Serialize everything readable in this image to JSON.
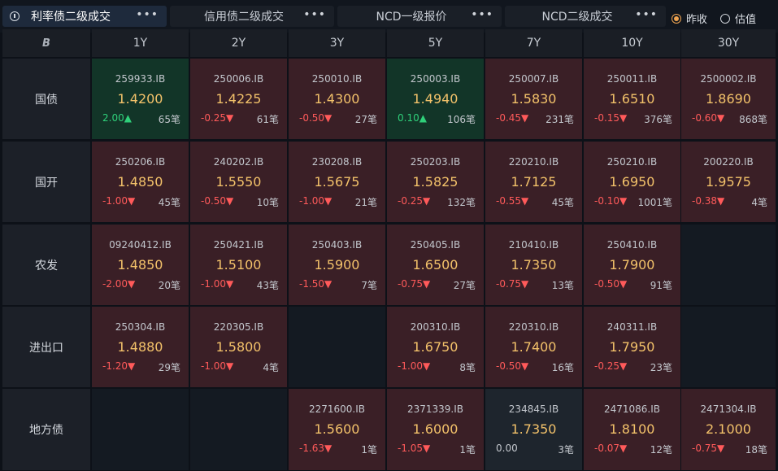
{
  "tabs": [
    {
      "label": "利率债二级成交",
      "active": true
    },
    {
      "label": "信用债二级成交",
      "active": false
    },
    {
      "label": "NCD一级报价",
      "active": false
    },
    {
      "label": "NCD二级成交",
      "active": false
    }
  ],
  "more_glyph": "•••",
  "radios": [
    {
      "label": "昨收",
      "selected": true
    },
    {
      "label": "估值",
      "selected": false
    }
  ],
  "corner_logo": "B",
  "tenors": [
    "1Y",
    "2Y",
    "3Y",
    "5Y",
    "7Y",
    "10Y",
    "30Y"
  ],
  "rows": [
    {
      "label": "国债",
      "cells": [
        {
          "code": "259933.IB",
          "yield": "1.4200",
          "change": "2.00▲",
          "dir": "up",
          "count": "65笔",
          "bg": "green"
        },
        {
          "code": "250006.IB",
          "yield": "1.4225",
          "change": "-0.25▼",
          "dir": "down",
          "count": "61笔",
          "bg": "red"
        },
        {
          "code": "250010.IB",
          "yield": "1.4300",
          "change": "-0.50▼",
          "dir": "down",
          "count": "27笔",
          "bg": "red"
        },
        {
          "code": "250003.IB",
          "yield": "1.4940",
          "change": "0.10▲",
          "dir": "up",
          "count": "106笔",
          "bg": "green"
        },
        {
          "code": "250007.IB",
          "yield": "1.5830",
          "change": "-0.45▼",
          "dir": "down",
          "count": "231笔",
          "bg": "red"
        },
        {
          "code": "250011.IB",
          "yield": "1.6510",
          "change": "-0.15▼",
          "dir": "down",
          "count": "376笔",
          "bg": "red"
        },
        {
          "code": "2500002.IB",
          "yield": "1.8690",
          "change": "-0.60▼",
          "dir": "down",
          "count": "868笔",
          "bg": "red"
        }
      ]
    },
    {
      "label": "国开",
      "cells": [
        {
          "code": "250206.IB",
          "yield": "1.4850",
          "change": "-1.00▼",
          "dir": "down",
          "count": "45笔",
          "bg": "red"
        },
        {
          "code": "240202.IB",
          "yield": "1.5550",
          "change": "-0.50▼",
          "dir": "down",
          "count": "10笔",
          "bg": "red"
        },
        {
          "code": "230208.IB",
          "yield": "1.5675",
          "change": "-1.00▼",
          "dir": "down",
          "count": "21笔",
          "bg": "red"
        },
        {
          "code": "250203.IB",
          "yield": "1.5825",
          "change": "-0.25▼",
          "dir": "down",
          "count": "132笔",
          "bg": "red"
        },
        {
          "code": "220210.IB",
          "yield": "1.7125",
          "change": "-0.55▼",
          "dir": "down",
          "count": "45笔",
          "bg": "red"
        },
        {
          "code": "250210.IB",
          "yield": "1.6950",
          "change": "-0.10▼",
          "dir": "down",
          "count": "1001笔",
          "bg": "red"
        },
        {
          "code": "200220.IB",
          "yield": "1.9575",
          "change": "-0.38▼",
          "dir": "down",
          "count": "4笔",
          "bg": "red"
        }
      ]
    },
    {
      "label": "农发",
      "cells": [
        {
          "code": "09240412.IB",
          "yield": "1.4850",
          "change": "-2.00▼",
          "dir": "down",
          "count": "20笔",
          "bg": "red"
        },
        {
          "code": "250421.IB",
          "yield": "1.5100",
          "change": "-1.00▼",
          "dir": "down",
          "count": "43笔",
          "bg": "red"
        },
        {
          "code": "250403.IB",
          "yield": "1.5900",
          "change": "-1.50▼",
          "dir": "down",
          "count": "7笔",
          "bg": "red"
        },
        {
          "code": "250405.IB",
          "yield": "1.6500",
          "change": "-0.75▼",
          "dir": "down",
          "count": "27笔",
          "bg": "red"
        },
        {
          "code": "210410.IB",
          "yield": "1.7350",
          "change": "-0.75▼",
          "dir": "down",
          "count": "13笔",
          "bg": "red"
        },
        {
          "code": "250410.IB",
          "yield": "1.7900",
          "change": "-0.50▼",
          "dir": "down",
          "count": "91笔",
          "bg": "red"
        },
        null
      ]
    },
    {
      "label": "进出口",
      "cells": [
        {
          "code": "250304.IB",
          "yield": "1.4880",
          "change": "-1.20▼",
          "dir": "down",
          "count": "29笔",
          "bg": "red"
        },
        {
          "code": "220305.IB",
          "yield": "1.5800",
          "change": "-1.00▼",
          "dir": "down",
          "count": "4笔",
          "bg": "red"
        },
        null,
        {
          "code": "200310.IB",
          "yield": "1.6750",
          "change": "-1.00▼",
          "dir": "down",
          "count": "8笔",
          "bg": "red"
        },
        {
          "code": "220310.IB",
          "yield": "1.7400",
          "change": "-0.50▼",
          "dir": "down",
          "count": "16笔",
          "bg": "red"
        },
        {
          "code": "240311.IB",
          "yield": "1.7950",
          "change": "-0.25▼",
          "dir": "down",
          "count": "23笔",
          "bg": "red"
        },
        null
      ]
    },
    {
      "label": "地方债",
      "cells": [
        null,
        null,
        {
          "code": "2271600.IB",
          "yield": "1.5600",
          "change": "-1.63▼",
          "dir": "down",
          "count": "1笔",
          "bg": "red"
        },
        {
          "code": "2371339.IB",
          "yield": "1.6000",
          "change": "-1.05▼",
          "dir": "down",
          "count": "1笔",
          "bg": "red"
        },
        {
          "code": "234845.IB",
          "yield": "1.7350",
          "change": "0.00",
          "dir": "flat",
          "count": "3笔",
          "bg": "gray"
        },
        {
          "code": "2471086.IB",
          "yield": "1.8100",
          "change": "-0.07▼",
          "dir": "down",
          "count": "12笔",
          "bg": "red"
        },
        {
          "code": "2471304.IB",
          "yield": "2.1000",
          "change": "-0.75▼",
          "dir": "down",
          "count": "18笔",
          "bg": "red"
        }
      ]
    }
  ]
}
